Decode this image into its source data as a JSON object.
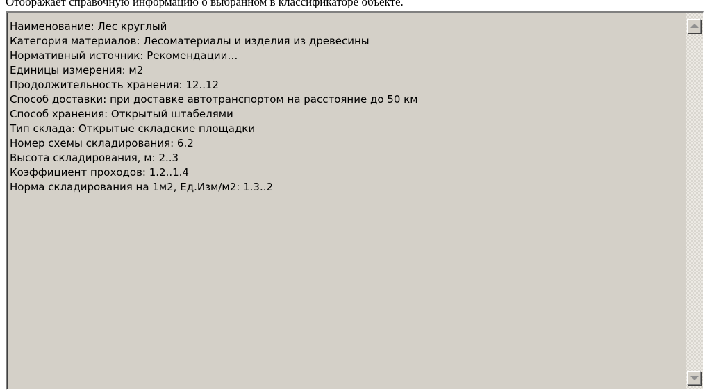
{
  "caption": "Отображает справочную информацию о выбранном в классификаторе объекте.",
  "info": {
    "lines": [
      "Наименование: Лес круглый",
      "Категория материалов: Лесоматериалы и изделия из древесины",
      "Нормативный источник: Рекомендации…",
      "Единицы измерения: м2",
      "Продолжительность хранения:  12..12",
      "Способ доставки: при доставке автотранспортом на расстояние до 50 км",
      "Способ хранения: Открытый штабелями",
      "Тип склада: Открытые складские площадки",
      "Номер схемы складирования: 6.2",
      "Высота складирования, м:  2..3",
      "Коэффициент проходов:  1.2..1.4",
      "Норма складирования на 1м2, Ед.Изм/м2:  1.3..2"
    ]
  },
  "scrollbar": {
    "up_icon": "arrow-up-icon",
    "down_icon": "arrow-down-icon"
  }
}
